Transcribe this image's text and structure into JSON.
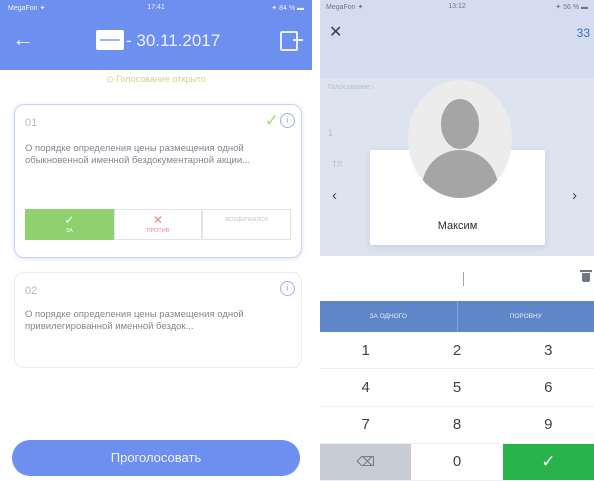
{
  "left": {
    "status_bar": {
      "carrier": "MegaFon ✦",
      "time": "17:41",
      "battery": "✦ 84 % ▬"
    },
    "header": {
      "back_icon": "back-arrow-icon",
      "date": "- 30.11.2017",
      "exit_icon": "exit-icon"
    },
    "voting_status": "⊙ Голосование открыто",
    "questions": [
      {
        "number": "01",
        "text": "О порядке определения цены размещения одной обыкновенной именной бездокументарной акции...",
        "selected_check": "✓",
        "votes": [
          {
            "symbol": "✓",
            "label": "ЗА"
          },
          {
            "symbol": "✕",
            "label": "ПРОТИВ"
          },
          {
            "symbol": "",
            "label": "ВОЗДЕРЖАЛСЯ"
          }
        ]
      },
      {
        "number": "02",
        "text": "О порядке определения цены размещения одной привилегированной именной бездок..."
      }
    ],
    "submit_label": "Проголосовать",
    "accent_color": "#6c8ff0"
  },
  "right": {
    "status_bar": {
      "carrier": "MegaFon ✦",
      "time": "13:12",
      "battery": "✦ 56 % ▬"
    },
    "header": {
      "close_icon": "close-icon",
      "counter": "33"
    },
    "background": {
      "label": "Голосование ›",
      "row1": "1",
      "row2": "ТЛ"
    },
    "profile": {
      "name": "Максим",
      "avatar_icon": "person-silhouette-icon",
      "prev": "‹",
      "next": "›"
    },
    "mode_buttons": [
      "ЗА ОДНОГО",
      "ПОРОВНУ"
    ],
    "keypad": {
      "keys": [
        "1",
        "2",
        "3",
        "4",
        "5",
        "6",
        "7",
        "8",
        "9"
      ],
      "backspace": "⌫",
      "zero": "0",
      "confirm": "✓"
    },
    "accent_color": "#29b34c"
  }
}
